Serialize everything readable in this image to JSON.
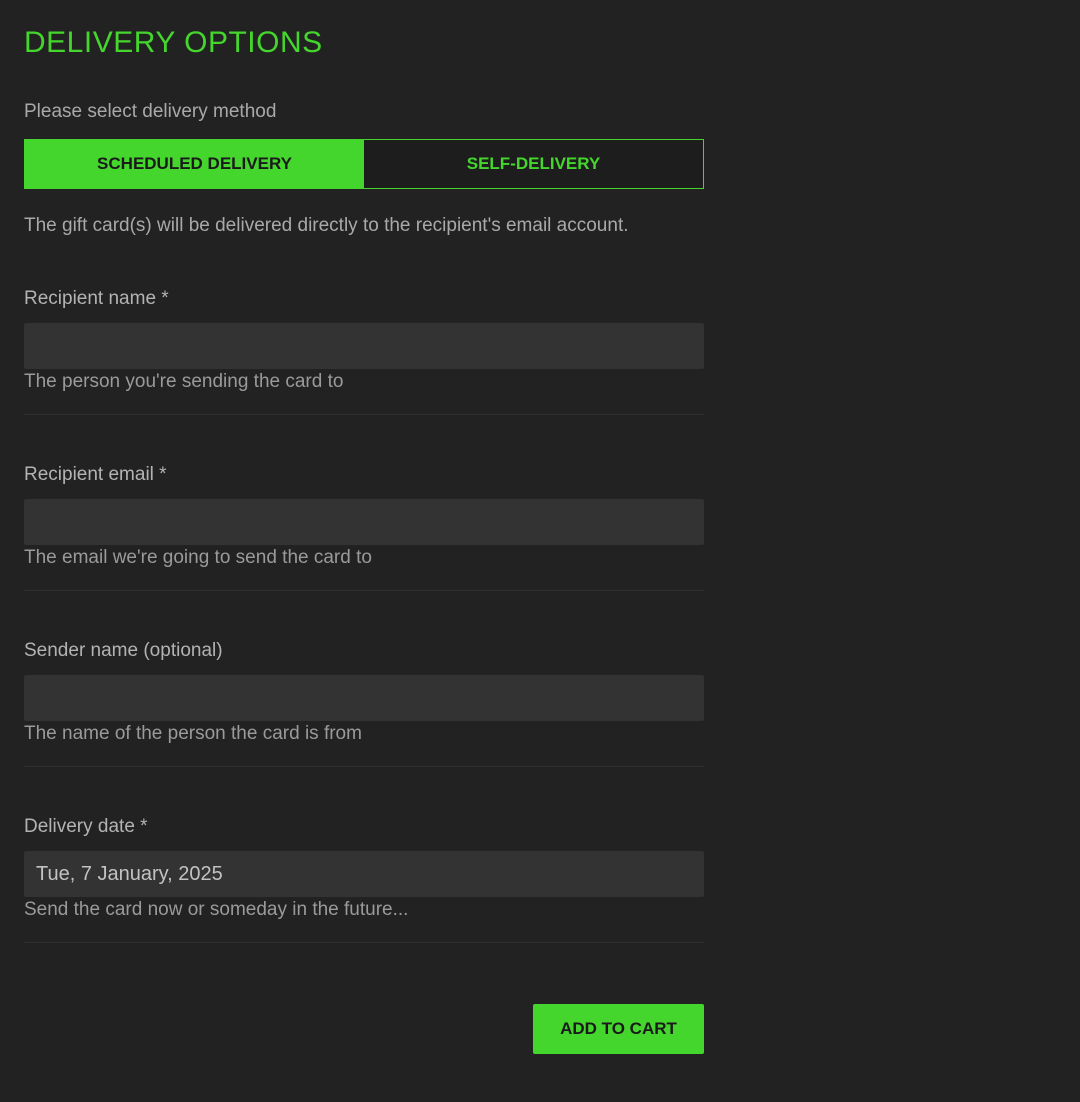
{
  "header": {
    "title": "DELIVERY OPTIONS"
  },
  "delivery_method": {
    "prompt": "Please select delivery method",
    "options": [
      {
        "label": "SCHEDULED DELIVERY",
        "selected": true
      },
      {
        "label": "SELF-DELIVERY",
        "selected": false
      }
    ],
    "info": "The gift card(s) will be delivered directly to the recipient's email account."
  },
  "form": {
    "recipient_name": {
      "label": "Recipient name *",
      "value": "",
      "help": "The person you're sending the card to"
    },
    "recipient_email": {
      "label": "Recipient email *",
      "value": "",
      "help": "The email we're going to send the card to"
    },
    "sender_name": {
      "label": "Sender name (optional)",
      "value": "",
      "help": "The name of the person the card is from"
    },
    "delivery_date": {
      "label": "Delivery date *",
      "value": "Tue, 7 January, 2025",
      "help": "Send the card now or someday in the future..."
    }
  },
  "actions": {
    "add_to_cart_label": "ADD TO CART"
  },
  "colors": {
    "accent": "#44d62c",
    "background": "#222222",
    "input_background": "#333333",
    "text": "#a9a9a9"
  }
}
